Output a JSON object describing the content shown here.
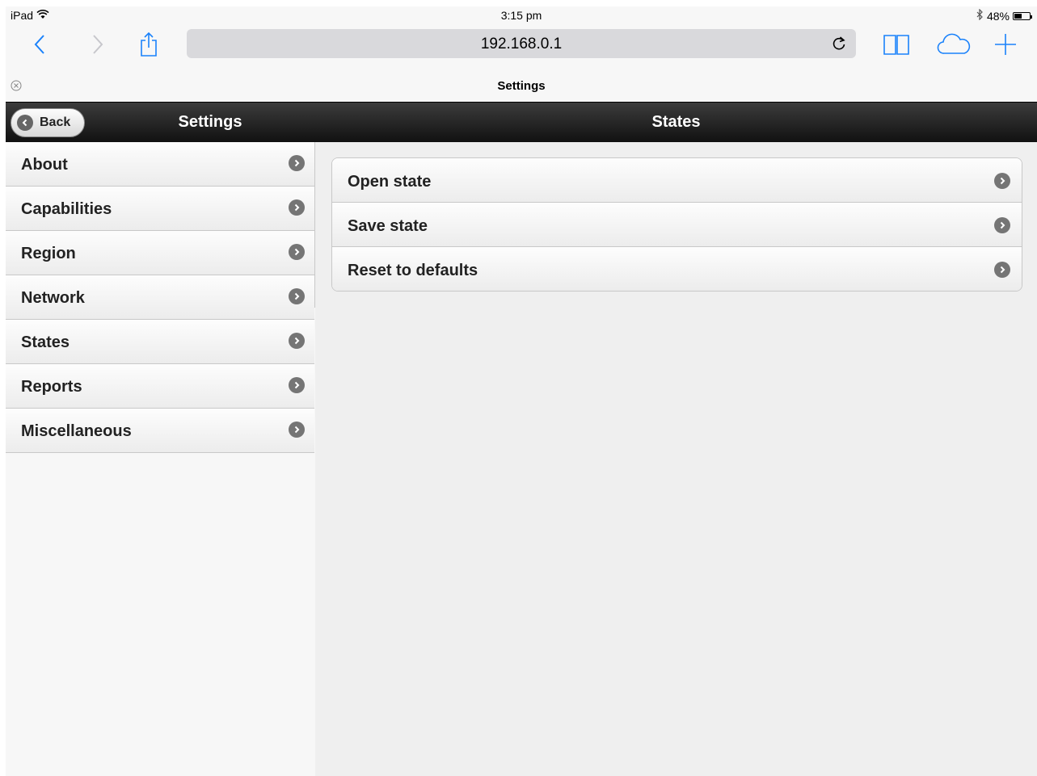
{
  "status_bar": {
    "device": "iPad",
    "time": "3:15 pm",
    "battery_percent": "48%",
    "battery_level": 0.48,
    "icons": [
      "wifi-icon",
      "bluetooth-icon",
      "battery-icon"
    ]
  },
  "browser": {
    "url": "192.168.0.1",
    "tab_title": "Settings",
    "icons": [
      "back-arrow-icon",
      "forward-arrow-icon",
      "share-icon",
      "reload-icon",
      "bookmarks-icon",
      "cloud-tabs-icon",
      "new-tab-icon",
      "close-tab-icon"
    ],
    "accent_color": "#1a82fb"
  },
  "header": {
    "back_label": "Back",
    "left_title": "Settings",
    "right_title": "States"
  },
  "sidebar": {
    "items": [
      {
        "label": "About"
      },
      {
        "label": "Capabilities"
      },
      {
        "label": "Region"
      },
      {
        "label": "Network"
      },
      {
        "label": "States"
      },
      {
        "label": "Reports"
      },
      {
        "label": "Miscellaneous"
      }
    ]
  },
  "main": {
    "items": [
      {
        "label": "Open state"
      },
      {
        "label": "Save state"
      },
      {
        "label": "Reset to defaults"
      }
    ]
  }
}
